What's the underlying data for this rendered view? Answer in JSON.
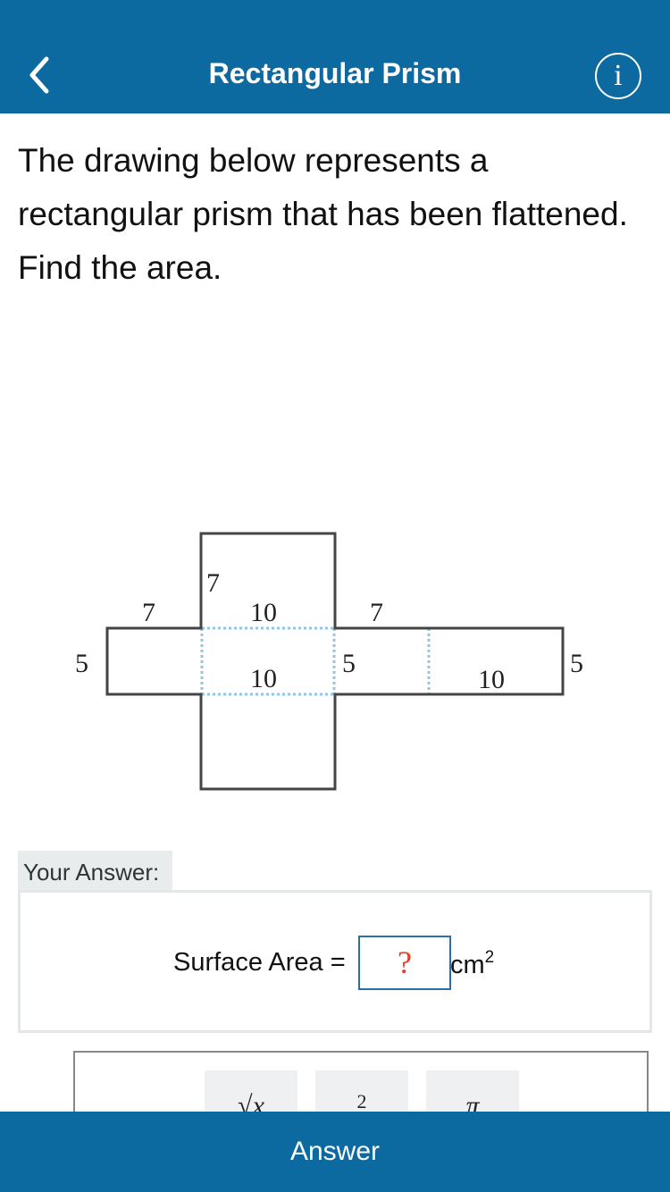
{
  "header": {
    "back_icon": "chevron-left-icon",
    "title": "Rectangular Prism",
    "info_icon_text": "i"
  },
  "question": {
    "text": "The drawing below represents a rectangular prism that has been flattened. Find the area."
  },
  "diagram": {
    "labels": {
      "top_face_side": "7",
      "left_face_top": "7",
      "center_top": "10",
      "right_face_top": "7",
      "left_height": "5",
      "center_middle": "10",
      "center_right_side": "5",
      "right_bottom": "10",
      "right_height": "5"
    }
  },
  "answer": {
    "label": "Your Answer:",
    "surface_area_label": "Surface Area =",
    "input_placeholder": "?",
    "unit": "cm",
    "unit_exponent": "2"
  },
  "keypad": {
    "keys": [
      "√x",
      "2",
      "π"
    ]
  },
  "footer": {
    "answer_button": "Answer"
  },
  "colors": {
    "brand_blue": "#0d6aa0",
    "placeholder_red": "#e0402a",
    "dotted_line": "#8cc6ea"
  }
}
